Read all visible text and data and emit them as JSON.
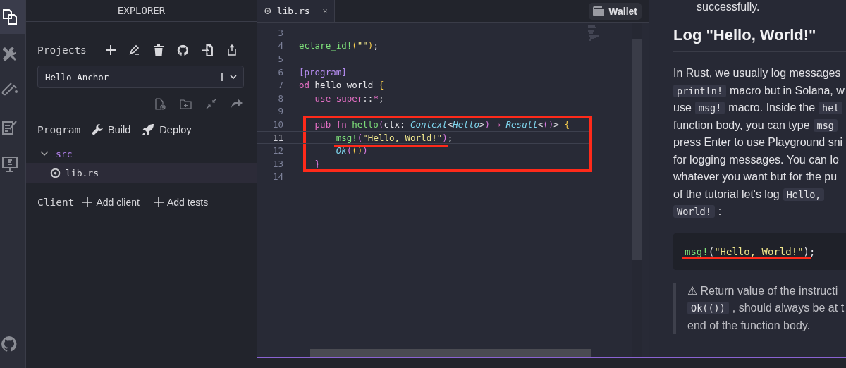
{
  "activity_bar": [
    {
      "kind": "files",
      "selected": true
    },
    {
      "kind": "tools",
      "selected": false
    },
    {
      "kind": "test",
      "selected": false
    },
    {
      "kind": "notes",
      "selected": false
    },
    {
      "kind": "monitor",
      "selected": false
    }
  ],
  "explorer": {
    "title": "EXPLORER",
    "projects": {
      "label": "Projects",
      "selected_project": "Hello Anchor"
    },
    "program": {
      "label": "Program",
      "build": "Build",
      "deploy": "Deploy"
    },
    "tree": [
      {
        "label": "src",
        "expanded": true,
        "children": [
          {
            "label": "lib.rs",
            "selected": true
          }
        ]
      }
    ],
    "client": {
      "label": "Client",
      "add_client": "Add client",
      "add_tests": "Add tests"
    }
  },
  "editor": {
    "tabs": [
      {
        "label": "lib.rs",
        "selected": true
      }
    ],
    "wallet": "Wallet",
    "code_groups": [
      {
        "kind": "plain",
        "lines": [
          {
            "number": "3",
            "current": false
          },
          {
            "number": "4",
            "current": false,
            "tokens": [
              {
                "text": "eclare_id!",
                "kind": "fn"
              },
              {
                "text": "(",
                "kind": "bracket"
              },
              {
                "text": "\"\"",
                "kind": "string"
              },
              {
                "text": ")",
                "kind": "bracket"
              },
              {
                "text": ";",
                "kind": "plain"
              }
            ]
          },
          {
            "number": "5",
            "current": false
          },
          {
            "number": "6",
            "current": false,
            "tokens": [
              {
                "text": "[program]",
                "kind": "attr"
              }
            ]
          },
          {
            "number": "7",
            "current": false,
            "tokens": [
              {
                "text": "od",
                "kind": "keyword"
              },
              {
                "text": " hello_world ",
                "kind": "plain"
              },
              {
                "text": "{",
                "kind": "bracket"
              }
            ]
          },
          {
            "number": "8",
            "current": false,
            "tokens": [
              {
                "text": "   use",
                "kind": "keyword"
              },
              {
                "text": " super",
                "kind": "keyword"
              },
              {
                "text": "::",
                "kind": "plain"
              },
              {
                "text": "*",
                "kind": "keyword"
              },
              {
                "text": ";",
                "kind": "plain"
              }
            ]
          },
          {
            "number": "9",
            "current": false
          }
        ]
      },
      {
        "kind": "annotated",
        "lines": [
          {
            "number": "10",
            "current": false,
            "tokens": [
              {
                "text": "   pub",
                "kind": "keyword"
              },
              {
                "text": " fn",
                "kind": "keyword"
              },
              {
                "text": " hello",
                "kind": "fn"
              },
              {
                "text": "(",
                "kind": "paren"
              },
              {
                "text": "ctx: ",
                "kind": "plain"
              },
              {
                "text": "Context",
                "kind": "type"
              },
              {
                "text": "<",
                "kind": "plain"
              },
              {
                "text": "Hello",
                "kind": "type"
              },
              {
                "text": ">",
                "kind": "plain"
              },
              {
                "text": ")",
                "kind": "paren"
              },
              {
                "text": " → ",
                "kind": "keyword"
              },
              {
                "text": "Result",
                "kind": "type"
              },
              {
                "text": "<",
                "kind": "plain"
              },
              {
                "text": "()",
                "kind": "paren"
              },
              {
                "text": "> ",
                "kind": "plain"
              },
              {
                "text": "{",
                "kind": "bracket"
              }
            ]
          },
          {
            "number": "11",
            "current": true,
            "tokens": [
              {
                "text": "       msg!",
                "kind": "fn"
              },
              {
                "text": "(",
                "kind": "paren"
              },
              {
                "text": "\"Hello, World!\"",
                "kind": "string"
              },
              {
                "text": ")",
                "kind": "paren"
              },
              {
                "text": ";",
                "kind": "plain"
              }
            ]
          },
          {
            "number": "12",
            "current": false,
            "tokens": [
              {
                "text": "       Ok",
                "kind": "type"
              },
              {
                "text": "(",
                "kind": "paren"
              },
              {
                "text": "()",
                "kind": "bracket"
              },
              {
                "text": ")",
                "kind": "paren"
              }
            ]
          },
          {
            "number": "13",
            "current": false,
            "tokens": [
              {
                "text": "   }",
                "kind": "paren"
              }
            ]
          }
        ]
      },
      {
        "kind": "plain",
        "lines": [
          {
            "number": "14",
            "current": false
          }
        ]
      }
    ]
  },
  "tutorial": {
    "cut_line": "successfully.",
    "heading": "Log \"Hello, World!\"",
    "paragraph": [
      [
        {
          "text": "In Rust, we usually log messages",
          "kind": "text"
        }
      ],
      [
        {
          "text": "println!",
          "kind": "code"
        },
        {
          "text": "macro but in Solana, w",
          "kind": "text"
        }
      ],
      [
        {
          "text": "use",
          "kind": "text"
        },
        {
          "text": "msg!",
          "kind": "code"
        },
        {
          "text": "macro. Inside the",
          "kind": "text"
        },
        {
          "text": "hel",
          "kind": "code"
        }
      ],
      [
        {
          "text": "function body, you can type",
          "kind": "text"
        },
        {
          "text": "msg",
          "kind": "code"
        }
      ],
      [
        {
          "text": "press Enter to use Playground sni",
          "kind": "text"
        }
      ],
      [
        {
          "text": "for logging messages. You can lo",
          "kind": "text"
        }
      ],
      [
        {
          "text": "whatever you want but for the pu",
          "kind": "text"
        }
      ],
      [
        {
          "text": "of the tutorial let's log",
          "kind": "text"
        },
        {
          "text": "Hello,",
          "kind": "code"
        }
      ],
      [
        {
          "text": "World!",
          "kind": "code"
        },
        {
          "text": ":",
          "kind": "text"
        }
      ]
    ],
    "code_block": {
      "tokens": [
        {
          "text": "msg!",
          "kind": "fn"
        },
        {
          "text": "(",
          "kind": "plain"
        },
        {
          "text": "\"Hello, World!\"",
          "kind": "string"
        },
        {
          "text": ");",
          "kind": "plain"
        }
      ]
    },
    "note": [
      [
        {
          "text": "⚠ Return value of the instructi",
          "kind": "text"
        }
      ],
      [
        {
          "text": "Ok(())",
          "kind": "code"
        },
        {
          "text": ", should always be at t",
          "kind": "text"
        }
      ],
      [
        {
          "text": "end of the function body.",
          "kind": "text"
        }
      ]
    ]
  }
}
